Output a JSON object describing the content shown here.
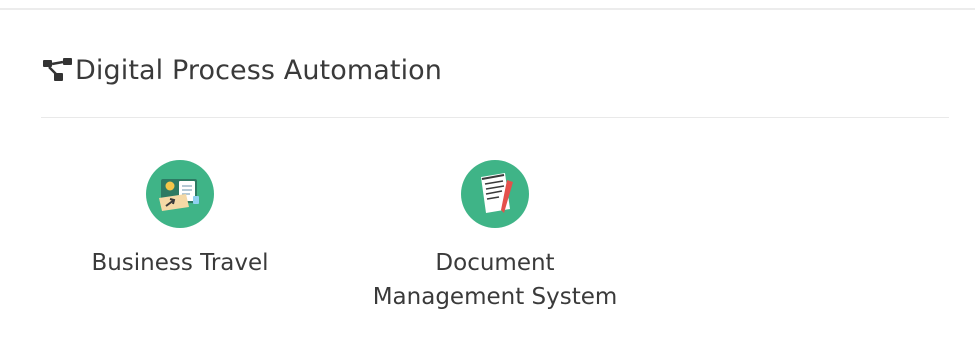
{
  "section": {
    "title": "Digital Process Automation",
    "icon": "workflow-icon"
  },
  "apps": [
    {
      "label": "Business Travel",
      "icon": "business-travel-icon"
    },
    {
      "label_line1": "Document",
      "label_line2": "Management System",
      "icon": "document-management-icon"
    }
  ],
  "colors": {
    "icon_circle": "#3fb487",
    "text": "#3a3a3a"
  }
}
